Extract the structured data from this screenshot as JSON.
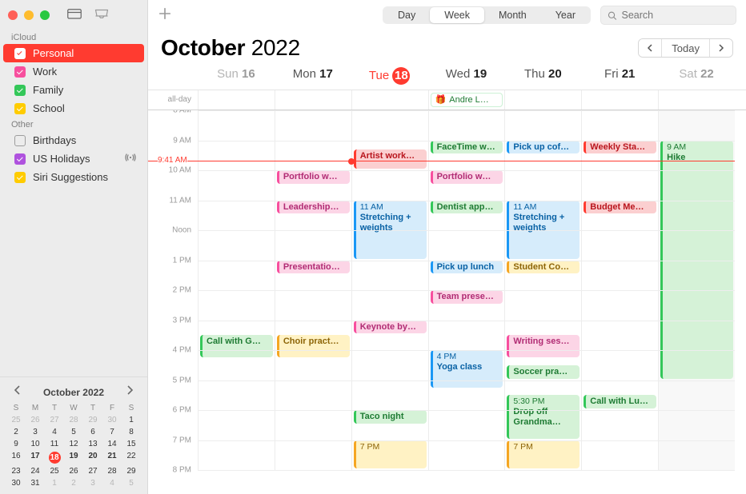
{
  "colors": {
    "red": "#ff3b30",
    "pink": "#f74f9e",
    "green": "#34c759",
    "yellow": "#ffcc00",
    "blue": "#1b98f5",
    "purple": "#af52de",
    "gray": "#8e8e93"
  },
  "event_palette": {
    "red": {
      "bg": "#fbcfd0",
      "border": "#ff3b30",
      "text": "#b9151d"
    },
    "pink": {
      "bg": "#fcd5e6",
      "border": "#f74f9e",
      "text": "#b12c74"
    },
    "green": {
      "bg": "#d5f2d7",
      "border": "#34c759",
      "text": "#1e7b33"
    },
    "blue": {
      "bg": "#d6ecfb",
      "border": "#1b98f5",
      "text": "#0962a5"
    },
    "yellow": {
      "bg": "#fff2c4",
      "border": "#f5a623",
      "text": "#8d6508"
    }
  },
  "sidebar": {
    "sections": [
      {
        "label": "iCloud",
        "items": [
          {
            "label": "Personal",
            "color": "red",
            "checked": true,
            "selected": true
          },
          {
            "label": "Work",
            "color": "pink",
            "checked": true
          },
          {
            "label": "Family",
            "color": "green",
            "checked": true
          },
          {
            "label": "School",
            "color": "yellow",
            "checked": true
          }
        ]
      },
      {
        "label": "Other",
        "items": [
          {
            "label": "Birthdays",
            "color": "gray",
            "checked": false
          },
          {
            "label": "US Holidays",
            "color": "purple",
            "checked": true,
            "broadcasting": true
          },
          {
            "label": "Siri Suggestions",
            "color": "yellow",
            "checked": true
          }
        ]
      }
    ]
  },
  "toolbar": {
    "views": [
      "Day",
      "Week",
      "Month",
      "Year"
    ],
    "active_view": "Week",
    "search_placeholder": "Search",
    "today_label": "Today"
  },
  "title": {
    "month": "October",
    "year": "2022"
  },
  "now": {
    "label": "9:41 AM",
    "day_index": 2
  },
  "week": {
    "days": [
      {
        "dow": "Sun",
        "num": "16",
        "dim": true
      },
      {
        "dow": "Mon",
        "num": "17"
      },
      {
        "dow": "Tue",
        "num": "18",
        "today": true
      },
      {
        "dow": "Wed",
        "num": "19"
      },
      {
        "dow": "Thu",
        "num": "20"
      },
      {
        "dow": "Fri",
        "num": "21"
      },
      {
        "dow": "Sat",
        "num": "22",
        "dim": true
      }
    ],
    "allday_label": "all-day",
    "allday": [
      {
        "day": 3,
        "title": "Andre L…",
        "color": "green",
        "icon": "gift"
      }
    ],
    "hours": {
      "start": 8,
      "end": 20,
      "row_h": 37.5
    },
    "events": [
      {
        "day": 0,
        "start": 15.5,
        "end": 16.3,
        "title": "Call with G…",
        "color": "green"
      },
      {
        "day": 1,
        "start": 10.0,
        "end": 10.5,
        "title": "Portfolio w…",
        "color": "pink"
      },
      {
        "day": 1,
        "start": 11.0,
        "end": 11.5,
        "title": "Leadership…",
        "color": "pink"
      },
      {
        "day": 1,
        "start": 13.0,
        "end": 13.5,
        "title": "Presentatio…",
        "color": "pink"
      },
      {
        "day": 1,
        "start": 15.5,
        "end": 16.3,
        "title": "Choir pract…",
        "color": "yellow"
      },
      {
        "day": 2,
        "start": 9.3,
        "end": 10.0,
        "title": "Artist work…",
        "color": "red"
      },
      {
        "day": 2,
        "start": 11.0,
        "end": 13.0,
        "title": "Stretching + weights",
        "time": "11 AM",
        "color": "blue"
      },
      {
        "day": 2,
        "start": 15.0,
        "end": 15.5,
        "title": "Keynote by…",
        "color": "pink"
      },
      {
        "day": 2,
        "start": 18.0,
        "end": 18.5,
        "title": "Taco night",
        "color": "green"
      },
      {
        "day": 2,
        "start": 19.0,
        "end": 20.0,
        "title": "",
        "time": "7 PM",
        "color": "yellow"
      },
      {
        "day": 3,
        "start": 9.0,
        "end": 9.5,
        "title": "FaceTime w…",
        "color": "green"
      },
      {
        "day": 3,
        "start": 10.0,
        "end": 10.5,
        "title": "Portfolio w…",
        "color": "pink"
      },
      {
        "day": 3,
        "start": 11.0,
        "end": 11.5,
        "title": "Dentist app…",
        "color": "green"
      },
      {
        "day": 3,
        "start": 13.0,
        "end": 13.5,
        "title": "Pick up lunch",
        "color": "blue"
      },
      {
        "day": 3,
        "start": 14.0,
        "end": 14.5,
        "title": "Team prese…",
        "color": "pink"
      },
      {
        "day": 3,
        "start": 16.0,
        "end": 17.3,
        "title": "Yoga class",
        "time": "4 PM",
        "color": "blue"
      },
      {
        "day": 4,
        "start": 9.0,
        "end": 9.5,
        "title": "Pick up cof…",
        "color": "blue"
      },
      {
        "day": 4,
        "start": 11.0,
        "end": 13.0,
        "title": "Stretching + weights",
        "time": "11 AM",
        "color": "blue"
      },
      {
        "day": 4,
        "start": 13.0,
        "end": 13.5,
        "title": "Student Co…",
        "color": "yellow"
      },
      {
        "day": 4,
        "start": 15.5,
        "end": 16.3,
        "title": "Writing ses…",
        "color": "pink"
      },
      {
        "day": 4,
        "start": 16.5,
        "end": 17.0,
        "title": "Soccer pra…",
        "color": "green"
      },
      {
        "day": 4,
        "start": 17.5,
        "end": 19.0,
        "title": "Drop off Grandma…",
        "time": "5:30 PM",
        "color": "green"
      },
      {
        "day": 4,
        "start": 19.0,
        "end": 20.0,
        "title": "",
        "time": "7 PM",
        "color": "yellow"
      },
      {
        "day": 5,
        "start": 9.0,
        "end": 9.5,
        "title": "Weekly Sta…",
        "color": "red"
      },
      {
        "day": 5,
        "start": 11.0,
        "end": 11.5,
        "title": "Budget Me…",
        "color": "red"
      },
      {
        "day": 5,
        "start": 17.5,
        "end": 18.0,
        "title": "Call with Lu…",
        "color": "green"
      },
      {
        "day": 6,
        "start": 9.0,
        "end": 17.0,
        "title": "Hike",
        "time": "9 AM",
        "color": "green"
      }
    ]
  },
  "mini_cal": {
    "title": "October 2022",
    "dow": [
      "S",
      "M",
      "T",
      "W",
      "T",
      "F",
      "S"
    ],
    "weeks": [
      [
        {
          "n": 25,
          "dim": true
        },
        {
          "n": 26,
          "dim": true
        },
        {
          "n": 27,
          "dim": true
        },
        {
          "n": 28,
          "dim": true
        },
        {
          "n": 29,
          "dim": true
        },
        {
          "n": 30,
          "dim": true
        },
        {
          "n": 1
        }
      ],
      [
        {
          "n": 2
        },
        {
          "n": 3
        },
        {
          "n": 4
        },
        {
          "n": 5
        },
        {
          "n": 6
        },
        {
          "n": 7
        },
        {
          "n": 8
        }
      ],
      [
        {
          "n": 9
        },
        {
          "n": 10
        },
        {
          "n": 11
        },
        {
          "n": 12
        },
        {
          "n": 13
        },
        {
          "n": 14
        },
        {
          "n": 15
        }
      ],
      [
        {
          "n": 16
        },
        {
          "n": 17,
          "bold": true
        },
        {
          "n": 18,
          "today": true,
          "bold": true
        },
        {
          "n": 19,
          "bold": true
        },
        {
          "n": 20,
          "bold": true
        },
        {
          "n": 21,
          "bold": true
        },
        {
          "n": 22
        }
      ],
      [
        {
          "n": 23
        },
        {
          "n": 24
        },
        {
          "n": 25
        },
        {
          "n": 26
        },
        {
          "n": 27
        },
        {
          "n": 28
        },
        {
          "n": 29
        }
      ],
      [
        {
          "n": 30
        },
        {
          "n": 31
        },
        {
          "n": 1,
          "dim": true
        },
        {
          "n": 2,
          "dim": true
        },
        {
          "n": 3,
          "dim": true
        },
        {
          "n": 4,
          "dim": true
        },
        {
          "n": 5,
          "dim": true
        }
      ]
    ]
  }
}
